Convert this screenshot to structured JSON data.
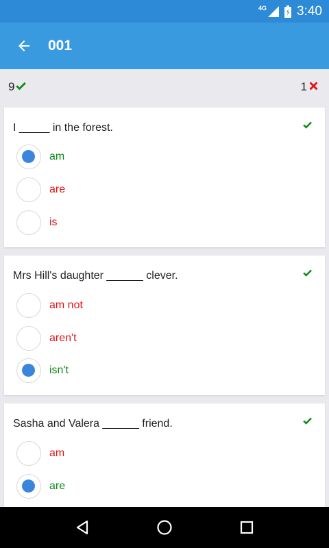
{
  "status": {
    "time": "3:40",
    "network": "4G"
  },
  "appbar": {
    "title": "001"
  },
  "score": {
    "correct": "9",
    "wrong": "1"
  },
  "questions": [
    {
      "text": "I _____ in the forest.",
      "result": "correct",
      "options": [
        {
          "label": "am",
          "selected": true,
          "color": "#0c8a1a"
        },
        {
          "label": "are",
          "selected": false,
          "color": "#e01414"
        },
        {
          "label": "is",
          "selected": false,
          "color": "#e01414"
        }
      ]
    },
    {
      "text": "Mrs Hill's daughter ______ clever.",
      "result": "correct",
      "options": [
        {
          "label": "am not",
          "selected": false,
          "color": "#e01414"
        },
        {
          "label": "aren't",
          "selected": false,
          "color": "#e01414"
        },
        {
          "label": "isn't",
          "selected": true,
          "color": "#0c8a1a"
        }
      ]
    },
    {
      "text": "Sasha and Valera ______ friend.",
      "result": "correct",
      "options": [
        {
          "label": "am",
          "selected": false,
          "color": "#e01414"
        },
        {
          "label": "are",
          "selected": true,
          "color": "#0c8a1a"
        }
      ]
    }
  ],
  "colors": {
    "primary": "#3a9ae0",
    "statusbar": "#2c8ad6",
    "correct": "#0c8a1a",
    "wrong": "#e01414",
    "radio": "#3a86dc"
  }
}
